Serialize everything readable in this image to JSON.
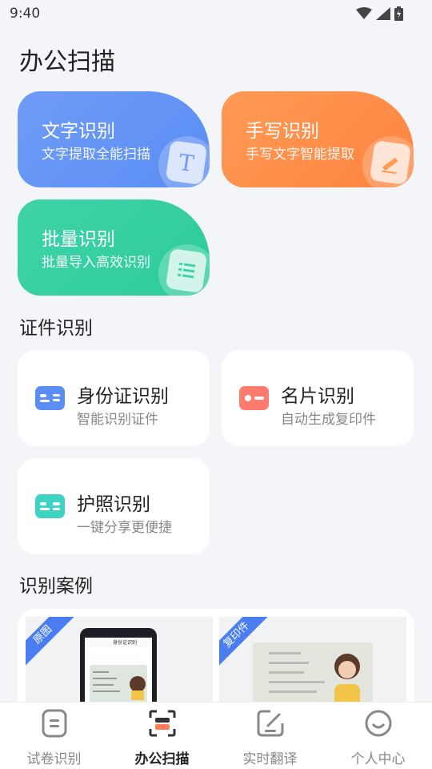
{
  "status": {
    "time": "9:40"
  },
  "page": {
    "title": "办公扫描"
  },
  "features": [
    {
      "title": "文字识别",
      "subtitle": "文字提取全能扫描",
      "icon": "text-T-icon"
    },
    {
      "title": "手写识别",
      "subtitle": "手写文字智能提取",
      "icon": "pen-icon"
    },
    {
      "title": "批量识别",
      "subtitle": "批量导入高效识别",
      "icon": "list-icon"
    }
  ],
  "id_section": {
    "title": "证件识别",
    "items": [
      {
        "title": "身份证识别",
        "subtitle": "智能识别证件",
        "color": "#5b8ef5"
      },
      {
        "title": "名片识别",
        "subtitle": "自动生成复印件",
        "color": "#ff7b6e"
      },
      {
        "title": "护照识别",
        "subtitle": "一键分享更便捷",
        "color": "#3fd3c3"
      }
    ]
  },
  "cases": {
    "title": "识别案例",
    "items": [
      {
        "tag": "原图",
        "phone_header": "身份证识别"
      },
      {
        "tag": "复印件"
      }
    ]
  },
  "nav": [
    {
      "label": "试卷识别",
      "icon": "document-icon",
      "active": false
    },
    {
      "label": "办公扫描",
      "icon": "scan-icon",
      "active": true
    },
    {
      "label": "实时翻译",
      "icon": "edit-icon",
      "active": false
    },
    {
      "label": "个人中心",
      "icon": "smile-icon",
      "active": false
    }
  ],
  "colors": {
    "blue": "#5b8ef5",
    "orange": "#ff8440",
    "green": "#2ecb9c",
    "background": "#f4f5f9"
  }
}
